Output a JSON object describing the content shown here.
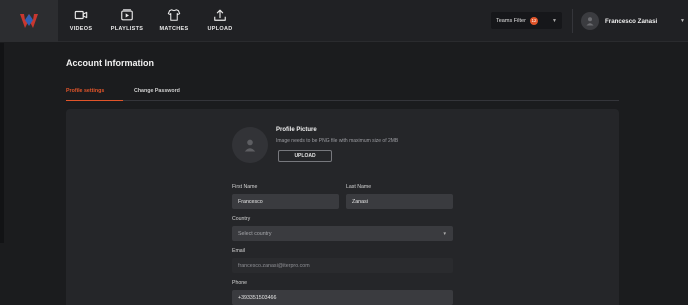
{
  "nav": {
    "items": [
      {
        "label": "VIDEOS",
        "icon": "video-icon"
      },
      {
        "label": "PLAYLISTS",
        "icon": "playlist-icon"
      },
      {
        "label": "MATCHES",
        "icon": "jersey-icon"
      },
      {
        "label": "UPLOAD",
        "icon": "upload-icon"
      }
    ]
  },
  "header": {
    "teams_filter_label": "Teams Filter",
    "teams_filter_count": "12",
    "user_name": "Francesco Zanasi"
  },
  "page": {
    "title": "Account Information",
    "tabs": [
      {
        "label": "Profile settings",
        "active": true
      },
      {
        "label": "Change Password",
        "active": false
      }
    ]
  },
  "profile": {
    "picture_title": "Profile Picture",
    "picture_hint": "Image needs to be PNG file with maximum size of 2MB",
    "upload_label": "UPLOAD"
  },
  "form": {
    "first_name_label": "First Name",
    "first_name_value": "Francesco",
    "last_name_label": "Last Name",
    "last_name_value": "Zanasi",
    "country_label": "Country",
    "country_placeholder": "Select country",
    "email_label": "Email",
    "email_value": "francesco.zanasi@iterpro.com",
    "phone_label": "Phone",
    "phone_value": "+393351503466"
  },
  "colors": {
    "accent": "#e2552a",
    "background": "#1b1c1e",
    "card": "#252629",
    "input": "#3a3b3f"
  }
}
